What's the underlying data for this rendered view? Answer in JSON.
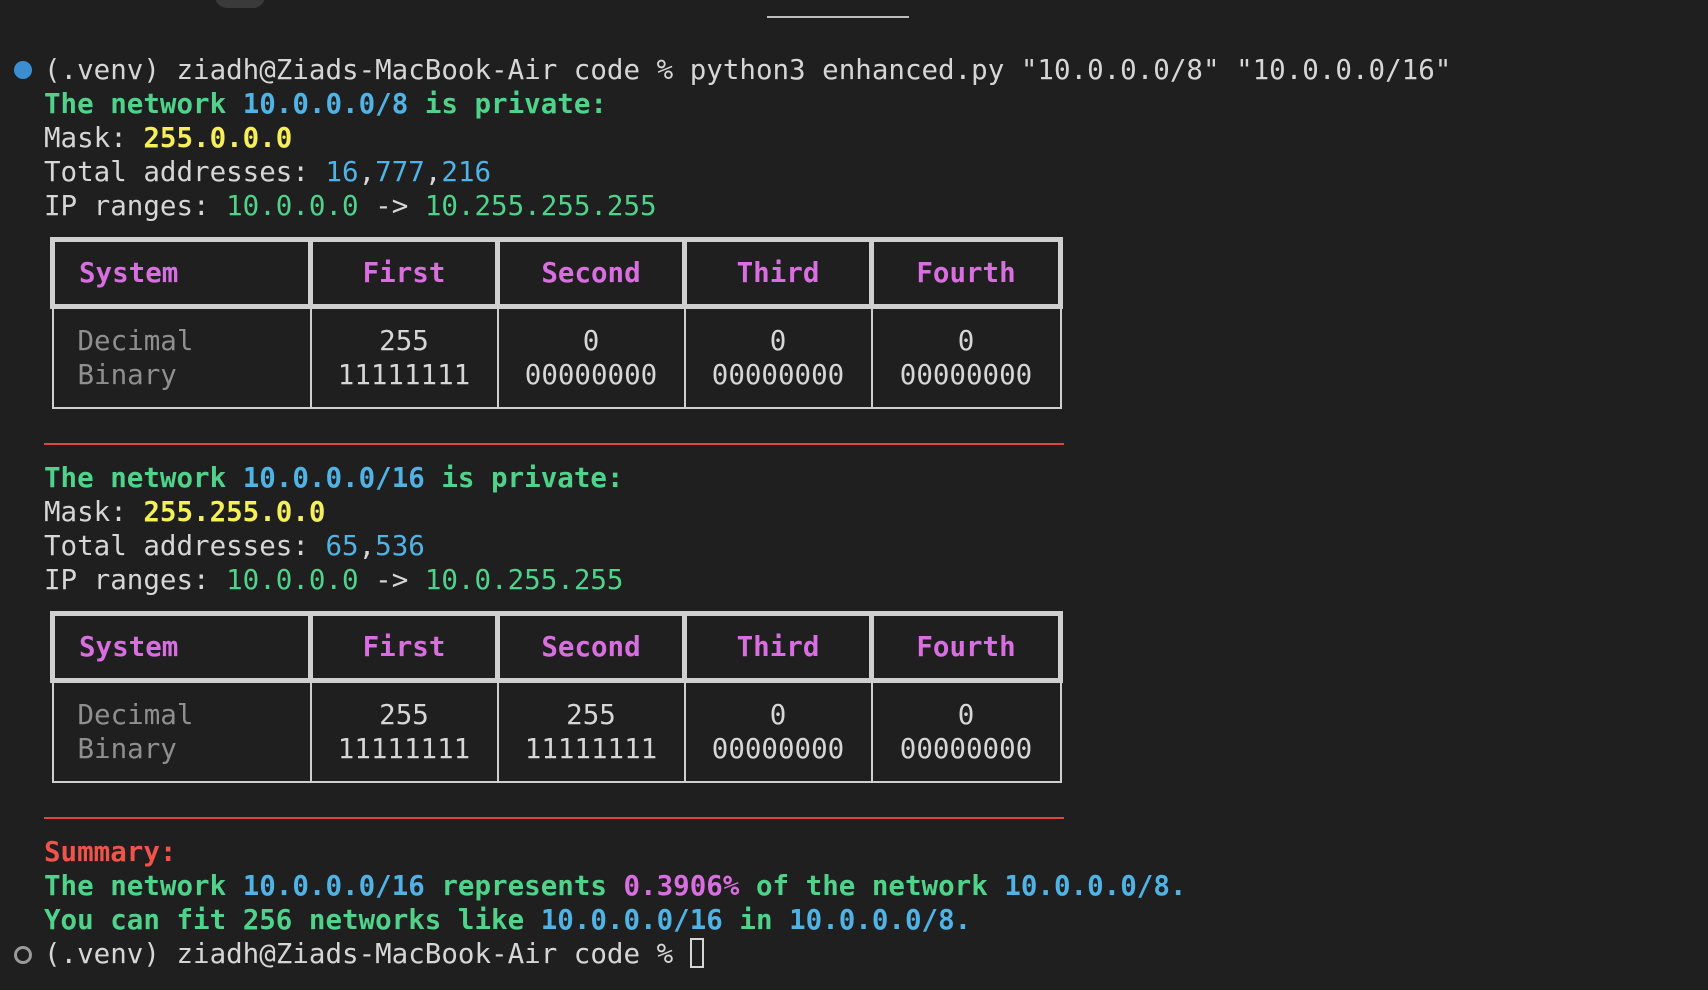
{
  "command": {
    "prompt": "(.venv) ziadh@Ziads-MacBook-Air code %",
    "command_text": " python3 enhanced.py \"10.0.0.0/8\" \"10.0.0.0/16\""
  },
  "networks": [
    {
      "header_prefix": "The network ",
      "cidr": "10.0.0.0/8",
      "header_suffix": " is private:",
      "mask_label": "Mask: ",
      "mask": "255.0.0.0",
      "total_label": "Total addresses: ",
      "total_parts": [
        "16",
        ",",
        "777",
        ",",
        "216"
      ],
      "ranges_label": "IP ranges: ",
      "range_start": "10.0.0.0",
      "range_arrow": " -> ",
      "range_end": "10.255.255.255",
      "table": {
        "headers": [
          "System",
          "First",
          "Second",
          "Third",
          "Fourth"
        ],
        "row_labels": [
          "Decimal",
          "Binary"
        ],
        "decimal": [
          "255",
          "0",
          "0",
          "0"
        ],
        "binary": [
          "11111111",
          "00000000",
          "00000000",
          "00000000"
        ]
      }
    },
    {
      "header_prefix": "The network ",
      "cidr": "10.0.0.0/16",
      "header_suffix": " is private:",
      "mask_label": "Mask: ",
      "mask": "255.255.0.0",
      "total_label": "Total addresses: ",
      "total_parts": [
        "65",
        ",",
        "536"
      ],
      "ranges_label": "IP ranges: ",
      "range_start": "10.0.0.0",
      "range_arrow": " -> ",
      "range_end": "10.0.255.255",
      "table": {
        "headers": [
          "System",
          "First",
          "Second",
          "Third",
          "Fourth"
        ],
        "row_labels": [
          "Decimal",
          "Binary"
        ],
        "decimal": [
          "255",
          "255",
          "0",
          "0"
        ],
        "binary": [
          "11111111",
          "11111111",
          "00000000",
          "00000000"
        ]
      }
    }
  ],
  "summary": {
    "title": "Summary:",
    "line1_a": "The network ",
    "line1_b": "10.0.0.0/16",
    "line1_c": " represents ",
    "line1_d": "0.3906%",
    "line1_e": " of the network ",
    "line1_f": "10.0.0.0/8.",
    "line2_a": "You can fit ",
    "line2_b": "256",
    "line2_c": " networks like ",
    "line2_d": "10.0.0.0/16",
    "line2_e": " in ",
    "line2_f": "10.0.0.0/8."
  },
  "final_prompt": {
    "prompt": "(.venv) ziadh@Ziads-MacBook-Air code % "
  },
  "colors": {
    "background": "#1f1f1f",
    "green": "#4fd38a",
    "blue": "#4fb3e6",
    "yellow": "#f5ef5a",
    "magenta": "#d86ee0",
    "red": "#f0534a",
    "separator": "#e0443c"
  }
}
